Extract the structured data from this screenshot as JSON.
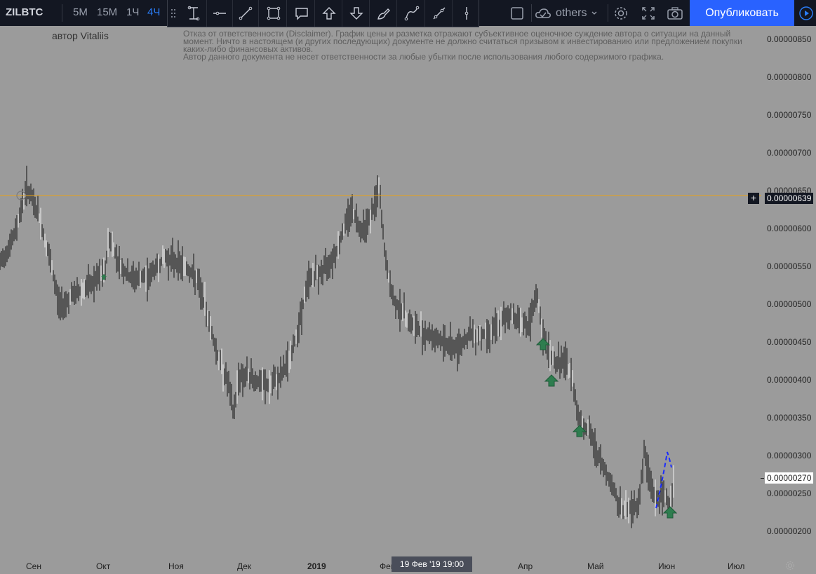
{
  "symbol": "ZILBTC",
  "timeframes": [
    "5М",
    "15М",
    "1Ч",
    "4Ч"
  ],
  "active_timeframe": "4Ч",
  "drawing_tools": [
    "cross-line-tool",
    "horizontal-line-tool",
    "trend-line-tool",
    "rectangle-tool",
    "callout-tool",
    "arrow-up-tool",
    "arrow-down-tool",
    "brush-tool",
    "path-tool",
    "ray-tool",
    "vertical-line-tool"
  ],
  "topbar": {
    "others_label": "others",
    "publish_label": "Опубликовать"
  },
  "author": "автор Vitaliis",
  "disclaimer": [
    "Отказ от ответственности (Disclaimer). График цены и разметка отражают субъективное оценочное суждение автора о ситуации на данный",
    "момент. Ничто в настоящем (и других последующих) документе не должно считаться призывом к инвестированию или предложением покупки",
    "каких-либо финансовых активов.",
    "Автор данного документа не несет ответственности за любые убытки после использования любого содержимого графика."
  ],
  "price_scale": {
    "labels": [
      "0.00000850",
      "0.00000800",
      "0.00000750",
      "0.00000700",
      "0.00000650",
      "0.00000600",
      "0.00000550",
      "0.00000500",
      "0.00000450",
      "0.00000400",
      "0.00000350",
      "0.00000300",
      "0.00000250",
      "0.00000200"
    ],
    "horizontal_line_price": "0.00000639",
    "last_price": "0.00000270",
    "horizontal_line_color": "#e8a317"
  },
  "time_scale": {
    "labels": [
      "Сен",
      "Окт",
      "Ноя",
      "Дек",
      "2019",
      "Фев",
      "Апр",
      "Май",
      "Июн",
      "Июл"
    ],
    "crosshair_label": "19 Фев '19   19:00"
  },
  "colors": {
    "background": "#9b9b9b",
    "toolbar": "#131722",
    "accent": "#2962ff",
    "marker": "#2e7d4f",
    "projection": "#1a2cff"
  }
}
